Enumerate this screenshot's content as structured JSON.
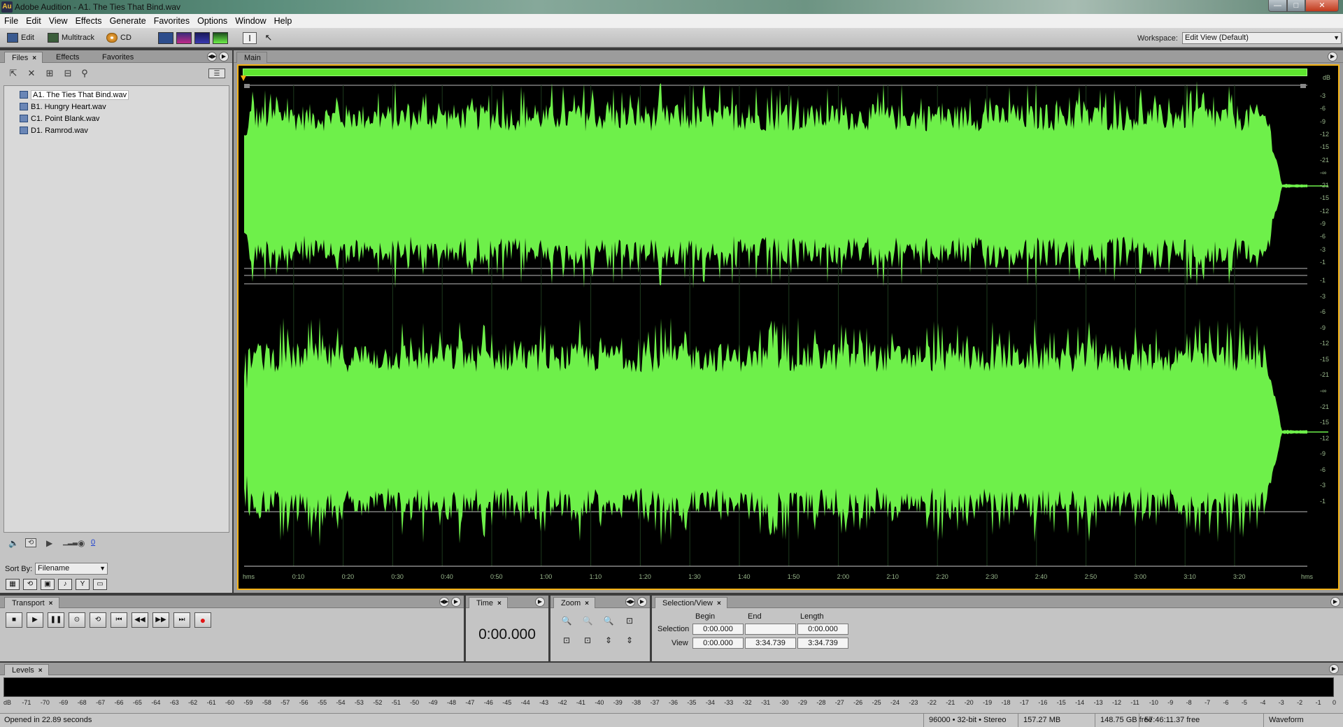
{
  "window": {
    "app_icon": "Au",
    "title": "Adobe Audition - A1. The Ties That Bind.wav",
    "min_symbol": "—",
    "max_symbol": "□",
    "close_symbol": "✕"
  },
  "menu": [
    "File",
    "Edit",
    "View",
    "Effects",
    "Generate",
    "Favorites",
    "Options",
    "Window",
    "Help"
  ],
  "toolbar": {
    "edit_label": "Edit",
    "multitrack_label": "Multitrack",
    "cd_label": "CD",
    "workspace_label": "Workspace:",
    "workspace_value": "Edit View (Default)"
  },
  "files_panel": {
    "tabs": [
      {
        "label": "Files",
        "active": true
      },
      {
        "label": "Effects",
        "active": false
      },
      {
        "label": "Favorites",
        "active": false
      }
    ],
    "files": [
      {
        "name": "A1. The Ties That Bind.wav",
        "selected": true
      },
      {
        "name": "B1. Hungry Heart.wav",
        "selected": false
      },
      {
        "name": "C1. Point Blank.wav",
        "selected": false
      },
      {
        "name": "D1. Ramrod.wav",
        "selected": false
      }
    ],
    "volume_value": "0",
    "sort_by_label": "Sort By:",
    "sort_by_value": "Filename"
  },
  "main_panel": {
    "tab_label": "Main",
    "time_ticks": [
      "hms",
      "0:10",
      "0:20",
      "0:30",
      "0:40",
      "0:50",
      "1:00",
      "1:10",
      "1:20",
      "1:30",
      "1:40",
      "1:50",
      "2:00",
      "2:10",
      "2:20",
      "2:30",
      "2:40",
      "2:50",
      "3:00",
      "3:10",
      "3:20",
      "hms"
    ],
    "db_unit": "dB",
    "db_ticks_channel": [
      "-3",
      "-6",
      "-9",
      "-12",
      "-15",
      "-21",
      "-∞",
      "-21",
      "-15",
      "-12",
      "-9",
      "-6",
      "-3",
      "-1"
    ],
    "db_ticks_channel2": [
      "-1",
      "-3",
      "-6",
      "-9",
      "-12",
      "-15",
      "-21",
      "-∞",
      "-21",
      "-15",
      "-12",
      "-9",
      "-6",
      "-3",
      "-1"
    ],
    "waveform_color": "#6ef04a",
    "background_color": "#000000"
  },
  "transport": {
    "tab_label": "Transport"
  },
  "time": {
    "tab_label": "Time",
    "value": "0:00.000"
  },
  "zoom": {
    "tab_label": "Zoom"
  },
  "selection_view": {
    "tab_label": "Selection/View",
    "begin_header": "Begin",
    "end_header": "End",
    "length_header": "Length",
    "selection_label": "Selection",
    "view_label": "View",
    "selection": {
      "begin": "0:00.000",
      "end": "",
      "length": "0:00.000"
    },
    "view": {
      "begin": "0:00.000",
      "end": "3:34.739",
      "length": "3:34.739"
    }
  },
  "levels": {
    "tab_label": "Levels",
    "scale": [
      "dB",
      "-71",
      "-70",
      "-69",
      "-68",
      "-67",
      "-66",
      "-65",
      "-64",
      "-63",
      "-62",
      "-61",
      "-60",
      "-59",
      "-58",
      "-57",
      "-56",
      "-55",
      "-54",
      "-53",
      "-52",
      "-51",
      "-50",
      "-49",
      "-48",
      "-47",
      "-46",
      "-45",
      "-44",
      "-43",
      "-42",
      "-41",
      "-40",
      "-39",
      "-38",
      "-37",
      "-36",
      "-35",
      "-34",
      "-33",
      "-32",
      "-31",
      "-30",
      "-29",
      "-28",
      "-27",
      "-26",
      "-25",
      "-24",
      "-23",
      "-22",
      "-21",
      "-20",
      "-19",
      "-18",
      "-17",
      "-16",
      "-15",
      "-14",
      "-13",
      "-12",
      "-11",
      "-10",
      "-9",
      "-8",
      "-7",
      "-6",
      "-5",
      "-4",
      "-3",
      "-2",
      "-1",
      "0"
    ]
  },
  "status": {
    "message": "Opened in 22.89 seconds",
    "format": "96000 • 32-bit • Stereo",
    "file_size": "157.27 MB",
    "disk_free": "148.75 GB free",
    "time_free": "57:46:11.37 free",
    "view_mode": "Waveform"
  },
  "icons": {
    "close": "close-icon",
    "panel_menu": "panel-menu-icon",
    "stop": "stop-icon",
    "play": "play-icon",
    "pause": "pause-icon",
    "record": "record-icon"
  }
}
